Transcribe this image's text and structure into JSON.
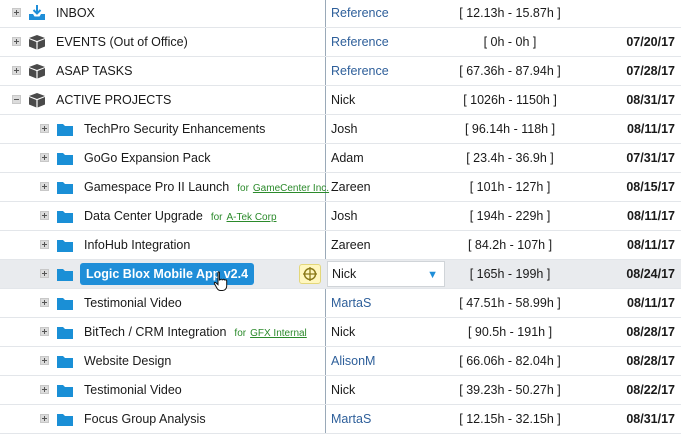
{
  "rows": [
    {
      "name": "INBOX",
      "icon": "inbox-icon",
      "owner": "Reference",
      "owner_link": true,
      "estimate": "[ 12.13h - 15.87h ]",
      "due": "",
      "client_prefix": "",
      "client": "",
      "expander": "plus",
      "level": 0
    },
    {
      "name": "EVENTS (Out of Office)",
      "icon": "box-icon",
      "owner": "Reference",
      "owner_link": true,
      "estimate": "[ 0h - 0h ]",
      "due": "07/20/17",
      "client_prefix": "",
      "client": "",
      "expander": "plus",
      "level": 0
    },
    {
      "name": "ASAP TASKS",
      "icon": "box-icon",
      "owner": "Reference",
      "owner_link": true,
      "estimate": "[ 67.36h - 87.94h ]",
      "due": "07/28/17",
      "client_prefix": "",
      "client": "",
      "expander": "plus",
      "level": 0
    },
    {
      "name": "ACTIVE PROJECTS",
      "icon": "box-icon",
      "owner": "Nick",
      "owner_link": false,
      "estimate": "[ 1026h - 1150h ]",
      "due": "08/31/17",
      "client_prefix": "",
      "client": "",
      "expander": "minus",
      "level": 0
    },
    {
      "name": "TechPro Security Enhancements",
      "icon": "folder-icon",
      "owner": "Josh",
      "owner_link": false,
      "estimate": "[ 96.14h - 118h ]",
      "due": "08/11/17",
      "client_prefix": "",
      "client": "",
      "expander": "plus",
      "level": 1
    },
    {
      "name": "GoGo Expansion Pack",
      "icon": "folder-icon",
      "owner": "Adam",
      "owner_link": false,
      "estimate": "[ 23.4h - 36.9h ]",
      "due": "07/31/17",
      "client_prefix": "",
      "client": "",
      "expander": "plus",
      "level": 1
    },
    {
      "name": "Gamespace Pro II Launch",
      "icon": "folder-icon",
      "owner": "Zareen",
      "owner_link": false,
      "estimate": "[ 101h - 127h ]",
      "due": "08/15/17",
      "client_prefix": "for",
      "client": "GameCenter Inc.",
      "expander": "plus",
      "level": 1
    },
    {
      "name": "Data Center Upgrade",
      "icon": "folder-icon",
      "owner": "Josh",
      "owner_link": false,
      "estimate": "[ 194h - 229h ]",
      "due": "08/11/17",
      "client_prefix": "for",
      "client": "A-Tek Corp",
      "expander": "plus",
      "level": 1
    },
    {
      "name": "InfoHub Integration",
      "icon": "folder-icon",
      "owner": "Zareen",
      "owner_link": false,
      "estimate": "[ 84.2h - 107h ]",
      "due": "08/11/17",
      "client_prefix": "",
      "client": "",
      "expander": "plus",
      "level": 1
    },
    {
      "name": "Logic Blox Mobile App v2.4",
      "icon": "folder-icon",
      "owner": "Nick",
      "owner_link": false,
      "estimate": "[ 165h - 199h ]",
      "due": "08/24/17",
      "client_prefix": "",
      "client": "",
      "expander": "plus",
      "level": 1,
      "selected": true
    },
    {
      "name": "Testimonial Video",
      "icon": "folder-icon",
      "owner": "MartaS",
      "owner_link": true,
      "estimate": "[ 47.51h - 58.99h ]",
      "due": "08/11/17",
      "client_prefix": "",
      "client": "",
      "expander": "plus",
      "level": 1
    },
    {
      "name": "BitTech / CRM Integration",
      "icon": "folder-icon",
      "owner": "Nick",
      "owner_link": false,
      "estimate": "[ 90.5h - 191h ]",
      "due": "08/28/17",
      "client_prefix": "for",
      "client": "GFX Internal",
      "expander": "plus",
      "level": 1
    },
    {
      "name": "Website Design",
      "icon": "folder-icon",
      "owner": "AlisonM",
      "owner_link": true,
      "estimate": "[ 66.06h - 82.04h ]",
      "due": "08/28/17",
      "client_prefix": "",
      "client": "",
      "expander": "plus",
      "level": 1
    },
    {
      "name": "Testimonial Video",
      "icon": "folder-icon",
      "owner": "Nick",
      "owner_link": false,
      "estimate": "[ 39.23h - 50.27h ]",
      "due": "08/22/17",
      "client_prefix": "",
      "client": "",
      "expander": "plus",
      "level": 1
    },
    {
      "name": "Focus Group Analysis",
      "icon": "folder-icon",
      "owner": "MartaS",
      "owner_link": true,
      "estimate": "[ 12.15h - 32.15h ]",
      "due": "08/31/17",
      "client_prefix": "",
      "client": "",
      "expander": "plus",
      "level": 1
    }
  ],
  "colors": {
    "folder": "#1a8fd6",
    "box": "#4a4a4a",
    "inbox": "#1f8ed8",
    "selected_chip": "#1f8ed8",
    "owner_link": "#2e5f9a",
    "client": "#2b8a2b",
    "dropdown_arrow": "#1f8ed8"
  },
  "icons": {
    "dropdown_arrow": "▼",
    "target": "target-icon",
    "cursor": "hand-cursor-icon"
  }
}
